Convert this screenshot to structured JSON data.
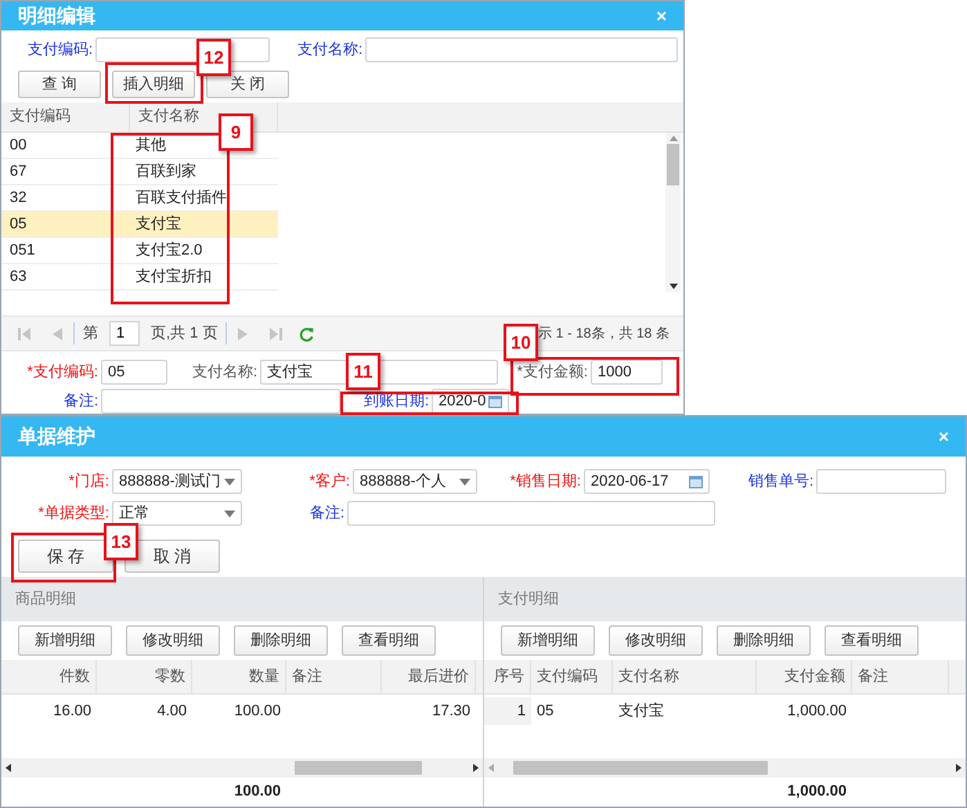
{
  "detail_dialog": {
    "title": "明细编辑",
    "close": "×",
    "search": [
      {
        "label": "支付编码:"
      },
      {
        "label": "支付名称:"
      }
    ],
    "buttons": [
      "查 询",
      "插入明细",
      "关 闭"
    ],
    "table": {
      "columns": [
        "支付编码",
        "支付名称"
      ],
      "rows": [
        {
          "code": "00",
          "name": "其他",
          "selected": false
        },
        {
          "code": "67",
          "name": "百联到家",
          "selected": false
        },
        {
          "code": "32",
          "name": "百联支付插件",
          "selected": false
        },
        {
          "code": "05",
          "name": "支付宝",
          "selected": true
        },
        {
          "code": "051",
          "name": "支付宝2.0",
          "selected": false
        },
        {
          "code": "63",
          "name": "支付宝折扣",
          "selected": false
        }
      ]
    },
    "pager": {
      "before": "第",
      "page": "1",
      "after": "页,共 1 页",
      "summary": "示 1 - 18条，共 18 条"
    },
    "form": [
      {
        "label": "*支付编码:",
        "value": "05",
        "color": "#f01010",
        "kind": "text"
      },
      {
        "label": "支付名称:",
        "value": "支付宝",
        "color": "#555555",
        "kind": "text"
      },
      {
        "label": "*支付金额:",
        "value": "1000",
        "color": "#555555",
        "kind": "text"
      },
      {
        "label": "备注:",
        "color": "#1a33e0",
        "kind": "text"
      },
      {
        "label": "到账日期:",
        "value": "2020-0",
        "color": "#1a33e0",
        "kind": "date"
      }
    ]
  },
  "document_dialog": {
    "title": "单据维护",
    "close": "×",
    "form": [
      {
        "label": "*门店:",
        "value": "888888-测试门",
        "color": "#f01010",
        "kind": "select"
      },
      {
        "label": "*客户:",
        "value": "888888-个人",
        "color": "#f01010",
        "kind": "select"
      },
      {
        "label": "*销售日期:",
        "value": "2020-06-17",
        "color": "#f01010",
        "kind": "date"
      },
      {
        "label": "销售单号:",
        "color": "#1a33e0",
        "kind": "text"
      },
      {
        "label": "*单据类型:",
        "value": "正常",
        "color": "#f01010",
        "kind": "select"
      },
      {
        "label": "备注:",
        "color": "#1a33e0",
        "kind": "text"
      }
    ],
    "buttons": [
      "保 存",
      "取 消"
    ],
    "panels": [
      {
        "title": "商品明细",
        "buttons": [
          "新增明细",
          "修改明细",
          "删除明细",
          "查看明细"
        ],
        "columns": [
          {
            "label": "件数"
          },
          {
            "label": "零数"
          },
          {
            "label": "数量",
            "total": "100.00"
          },
          {
            "label": "备注"
          },
          {
            "label": "最后进价"
          }
        ],
        "rows": [
          [
            "16.00",
            "4.00",
            "100.00",
            null,
            "17.30"
          ]
        ]
      },
      {
        "title": "支付明细",
        "buttons": [
          "新增明细",
          "修改明细",
          "删除明细",
          "查看明细"
        ],
        "columns": [
          {
            "label": "序号"
          },
          {
            "label": "支付编码"
          },
          {
            "label": "支付名称"
          },
          {
            "label": "支付金额",
            "total": "1,000.00"
          },
          {
            "label": "备注"
          }
        ],
        "rows": [
          [
            "1",
            "05",
            "支付宝",
            "1,000.00",
            null
          ]
        ]
      }
    ]
  },
  "callouts": [
    {
      "number": "12"
    },
    {
      "number": "9"
    },
    {
      "number": "10"
    },
    {
      "number": "11"
    },
    {
      "number": "13"
    }
  ]
}
